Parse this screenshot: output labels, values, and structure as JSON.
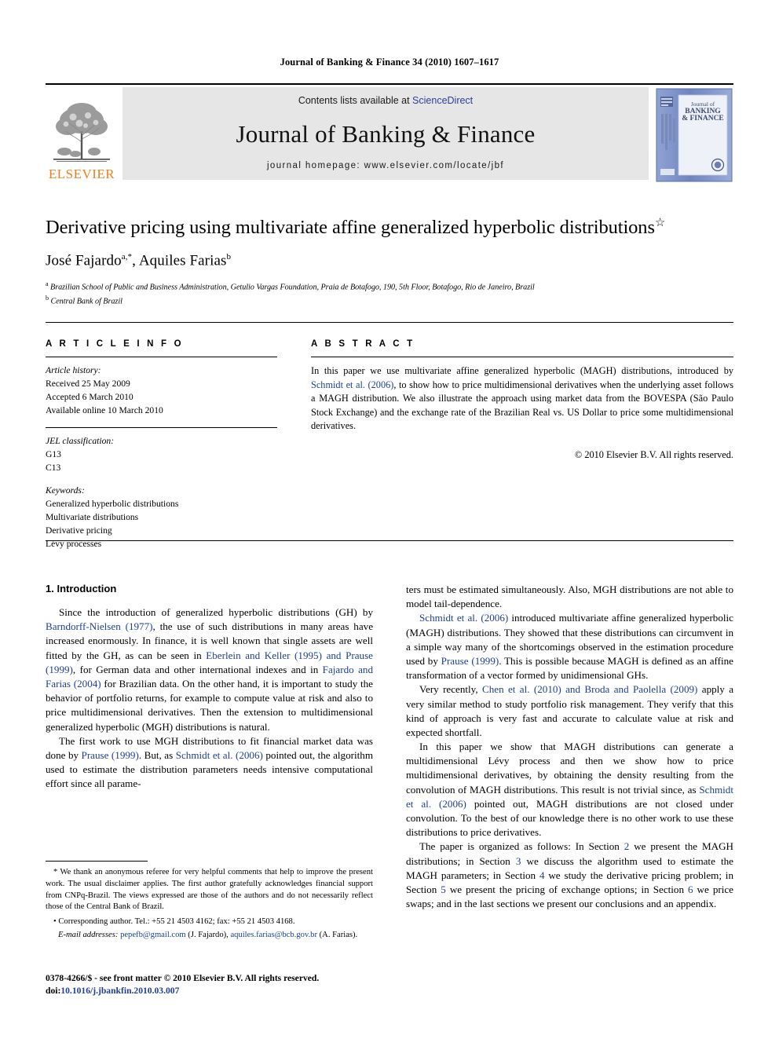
{
  "running_head": "Journal of Banking & Finance 34 (2010) 1607–1617",
  "masthead": {
    "contents_prefix": "Contents lists available at ",
    "sciencedirect": "ScienceDirect",
    "journal_title": "Journal of Banking & Finance",
    "homepage": "journal homepage: www.elsevier.com/locate/jbf",
    "publisher_wordmark": "ELSEVIER",
    "cover_title_line1": "Journal of",
    "cover_title_line2": "BANKING",
    "cover_title_line3": "& FINANCE"
  },
  "article": {
    "title": "Derivative pricing using multivariate affine generalized hyperbolic distributions",
    "title_footnote_mark": "☆",
    "authors": "José Fajardo",
    "author1": "José Fajardo",
    "author1_sup": "a,*",
    "author2": "Aquiles Farias",
    "author2_sup": "b",
    "affiliation_a_sup": "a",
    "affiliation_a": "Brazilian School of Public and Business Administration, Getulio Vargas Foundation, Praia de Botafogo, 190, 5th Floor, Botafogo, Rio de Janeiro, Brazil",
    "affiliation_b_sup": "b",
    "affiliation_b": "Central Bank of Brazil"
  },
  "article_info": {
    "heading": "A R T I C L E   I N F O",
    "history_label": "Article history:",
    "received": "Received 25 May 2009",
    "accepted": "Accepted 6 March 2010",
    "available": "Available online 10 March 2010",
    "jel_label": "JEL classification:",
    "jel_codes": [
      "G13",
      "C13"
    ],
    "keywords_label": "Keywords:",
    "keywords": [
      "Generalized hyperbolic distributions",
      "Multivariate distributions",
      "Derivative pricing",
      "Lévy processes"
    ]
  },
  "abstract": {
    "heading": "A B S T R A C T",
    "text_part1": "In this paper we use multivariate affine generalized hyperbolic (MAGH) distributions, introduced by ",
    "citation": "Schmidt et al. (2006)",
    "text_part2": ", to show how to price multidimensional derivatives when the underlying asset follows a MAGH distribution. We also illustrate the approach using market data from the BOVESPA (São Paulo Stock Exchange) and the exchange rate of the Brazilian Real vs. US Dollar to price some multidimensional derivatives.",
    "copyright": "© 2010 Elsevier B.V. All rights reserved."
  },
  "body": {
    "section1_title": "1. Introduction",
    "left": {
      "p1_a": "Since the introduction of generalized hyperbolic distributions (GH) by ",
      "p1_cite1": "Barndorff-Nielsen (1977)",
      "p1_b": ", the use of such distributions in many areas have increased enormously. In finance, it is well known that single assets are well fitted by the GH, as can be seen in ",
      "p1_cite2": "Eberlein and Keller (1995) and Prause (1999)",
      "p1_c": ", for German data and other international indexes and in ",
      "p1_cite3": "Fajardo and Farias (2004)",
      "p1_d": " for Brazilian data. On the other hand, it is important to study the behavior of portfolio returns, for example to compute value at risk and also to price multidimensional derivatives. Then the extension to multidimensional generalized hyperbolic (MGH) distributions is natural.",
      "p2_a": "The first work to use MGH distributions to fit financial market data was done by ",
      "p2_cite1": "Prause (1999)",
      "p2_b": ". But, as ",
      "p2_cite2": "Schmidt et al. (2006)",
      "p2_c": " pointed out, the algorithm used to estimate the distribution parameters needs intensive computational effort since all parame-"
    },
    "right": {
      "p1": "ters must be estimated simultaneously. Also, MGH distributions are not able to model tail-dependence.",
      "p2_cite1": "Schmidt et al. (2006)",
      "p2_a": " introduced multivariate affine generalized hyperbolic (MAGH) distributions. They showed that these distributions can circumvent in a simple way many of the shortcomings observed in the estimation procedure used by ",
      "p2_cite2": "Prause (1999)",
      "p2_b": ". This is possible because MAGH is defined as an affine transformation of a vector formed by unidimensional GHs.",
      "p3_a": "Very recently, ",
      "p3_cite1": "Chen et al. (2010) and Broda and Paolella (2009)",
      "p3_b": " apply a very similar method to study portfolio risk management. They verify that this kind of approach is very fast and accurate to calculate value at risk and expected shortfall.",
      "p4_a": "In this paper we show that MAGH distributions can generate a multidimensional Lévy process and then we show how to price multidimensional derivatives, by obtaining the density resulting from the convolution of MAGH distributions. This result is not trivial since, as ",
      "p4_cite1": "Schmidt et al. (2006)",
      "p4_b": " pointed out, MAGH distributions are not closed under convolution. To the best of our knowledge there is no other work to use these distributions to price derivatives.",
      "p5_a": "The paper is organized as follows: In Section ",
      "p5_s2": "2",
      "p5_b": " we present the MAGH distributions; in Section ",
      "p5_s3": "3",
      "p5_c": " we discuss the algorithm used to estimate the MAGH parameters; in Section ",
      "p5_s4": "4",
      "p5_d": " we study the derivative pricing problem; in Section ",
      "p5_s5": "5",
      "p5_e": " we present the pricing of exchange options; in Section ",
      "p5_s6": "6",
      "p5_f": " we price swaps; and in the last sections we present our conclusions and an appendix."
    }
  },
  "footnotes": {
    "star_mark": "*",
    "star_text": " We thank an anonymous referee for very helpful comments that help to improve the present work. The usual disclaimer applies. The first author gratefully acknowledges financial support from CNPq-Brazil. The views expressed are those of the authors and do not necessarily reflect those of the Central Bank of Brazil.",
    "corresponding_mark": "•",
    "corresponding_text": " Corresponding author. Tel.: +55 21 4503 4162; fax: +55 21 4503 4168.",
    "email_label": "E-mail addresses:",
    "email1": "pepefb@gmail.com",
    "email1_owner": " (J. Fajardo), ",
    "email2": "aquiles.farias@bcb.gov.br",
    "email2_owner": " (A. Farias)."
  },
  "footer": {
    "issn_line": "0378-4266/$ - see front matter © 2010 Elsevier B.V. All rights reserved.",
    "doi_label": "doi:",
    "doi_value": "10.1016/j.jbankfin.2010.03.007"
  },
  "colors": {
    "link_blue": "#1d3f94",
    "sciencedirect_blue": "#2a3f9d",
    "elsevier_orange": "#F07F1A",
    "banner_gray": "#e6e6e6",
    "cover_blue": "#7e92c8"
  }
}
